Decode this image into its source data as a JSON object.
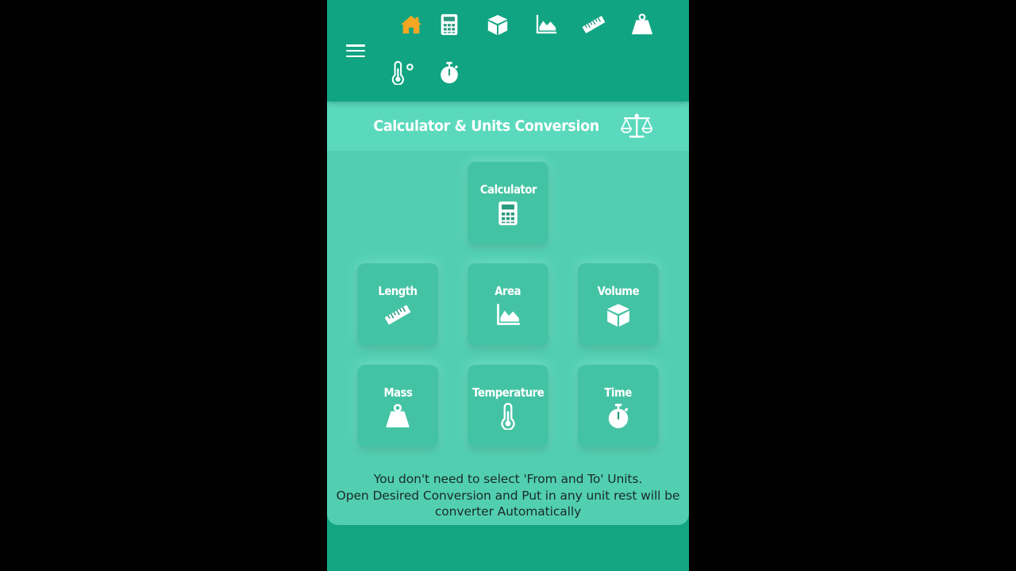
{
  "nav": {
    "icons": [
      "home-icon",
      "calculator-icon",
      "cube-icon",
      "area-chart-icon",
      "ruler-icon",
      "weight-icon",
      "thermometer-icon",
      "stopwatch-icon"
    ],
    "active_color": "#f5a623"
  },
  "header": {
    "title": "Calculator & Units Conversion",
    "icon": "balance-scale-icon"
  },
  "tiles": [
    {
      "label": "Calculator",
      "icon": "calculator-icon"
    },
    {
      "label": "Length",
      "icon": "ruler-icon"
    },
    {
      "label": "Area",
      "icon": "area-chart-icon"
    },
    {
      "label": "Volume",
      "icon": "cube-icon"
    },
    {
      "label": "Mass",
      "icon": "weight-icon"
    },
    {
      "label": "Temperature",
      "icon": "thermometer-icon"
    },
    {
      "label": "Time",
      "icon": "stopwatch-icon"
    }
  ],
  "note": {
    "line1": "You don't need to select 'From and To' Units.",
    "line2": "Open Desired Conversion and Put in any unit rest will be",
    "line3": "converter Automatically"
  },
  "colors": {
    "bar": "#10a482",
    "header_bg": "#5ad9bd",
    "panel_bg": "#52cfb1",
    "tile_bg": "#44c3a4"
  }
}
